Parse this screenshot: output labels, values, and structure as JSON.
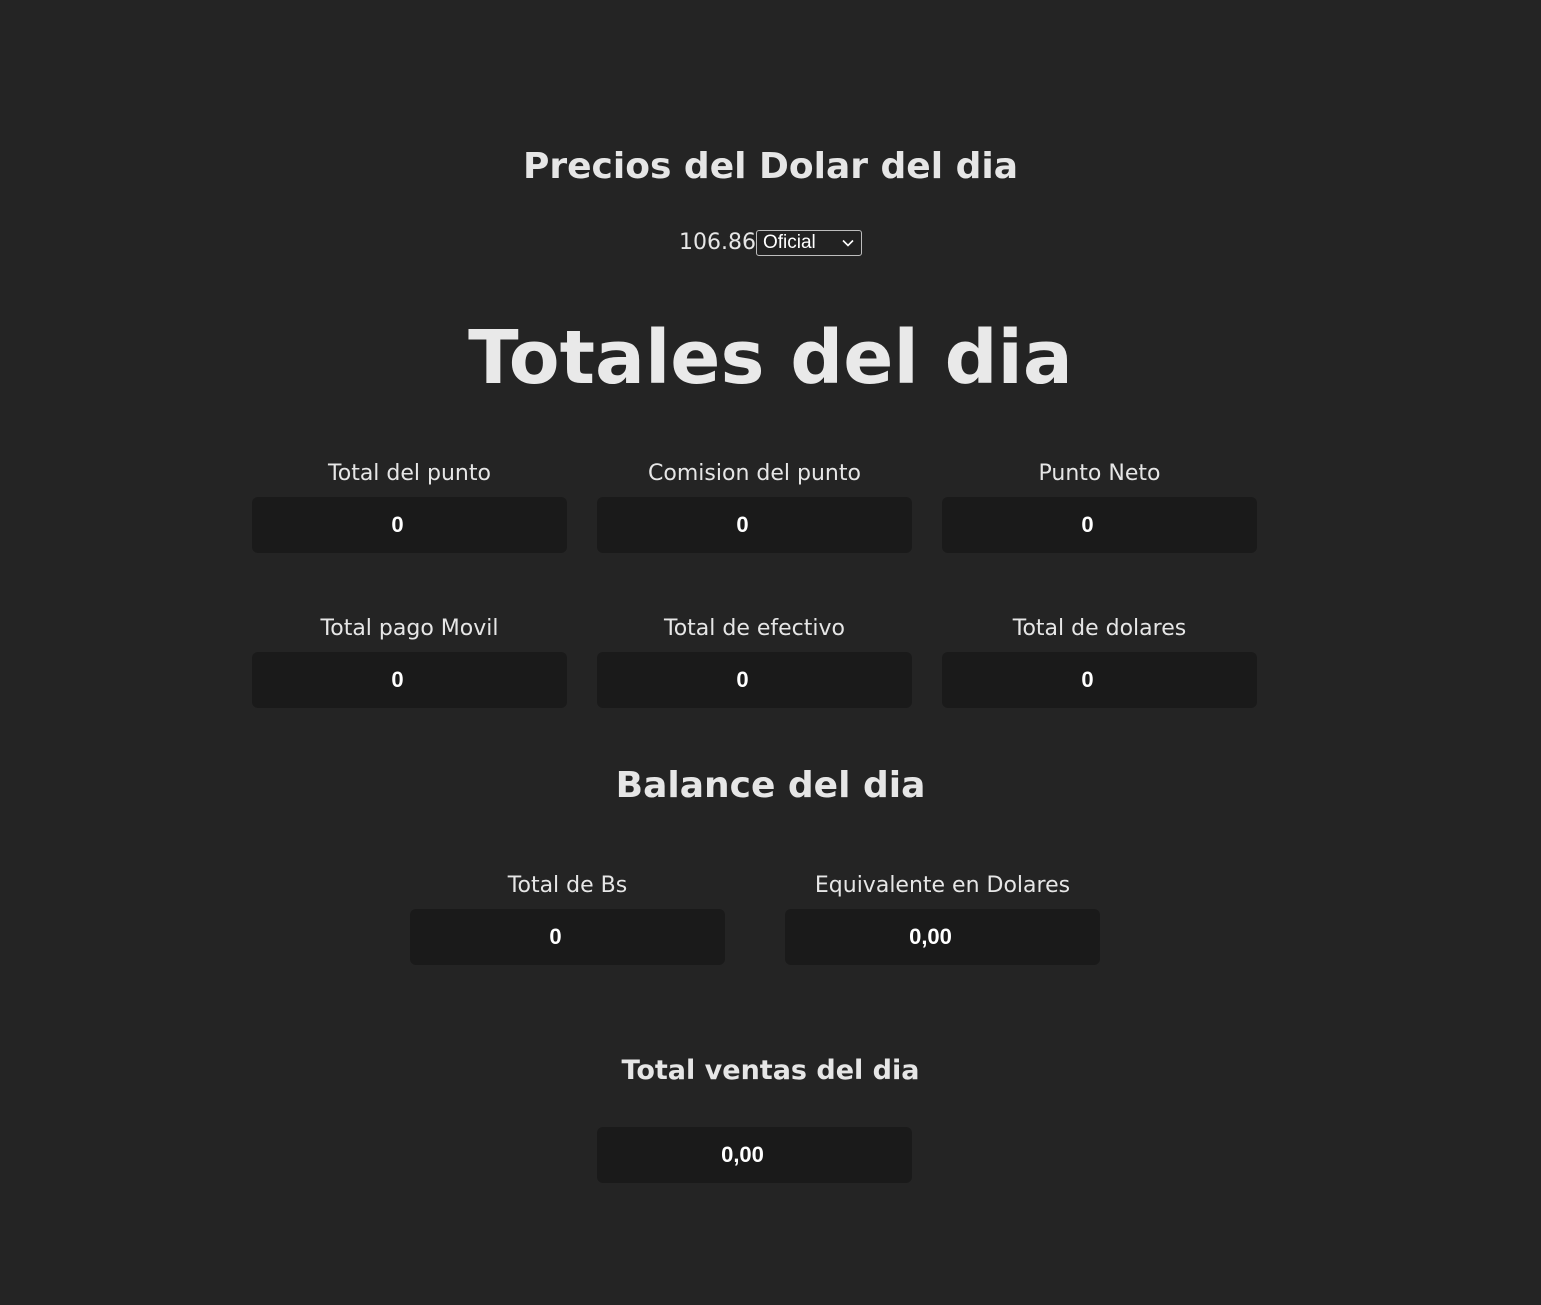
{
  "header": {
    "prices_title": "Precios del Dolar del dia",
    "rate_value": "106.86",
    "rate_selected": "Oficial"
  },
  "main": {
    "title": "Totales del dia",
    "totals": [
      {
        "label": "Total del punto",
        "value": "0"
      },
      {
        "label": "Comision del punto",
        "value": "0"
      },
      {
        "label": "Punto Neto",
        "value": "0"
      },
      {
        "label": "Total pago Movil",
        "value": "0"
      },
      {
        "label": "Total de efectivo",
        "value": "0"
      },
      {
        "label": "Total de dolares",
        "value": "0"
      }
    ]
  },
  "balance": {
    "title": "Balance del dia",
    "items": [
      {
        "label": "Total de Bs",
        "value": "0"
      },
      {
        "label": "Equivalente en Dolares",
        "value": "0,00"
      }
    ]
  },
  "sales": {
    "title": "Total ventas del dia",
    "value": "0,00"
  },
  "icons": {
    "select_chevron": "chevron-down-icon"
  },
  "colors": {
    "background": "#242424",
    "box": "#1a1a1a",
    "text": "#e6e6e6"
  }
}
